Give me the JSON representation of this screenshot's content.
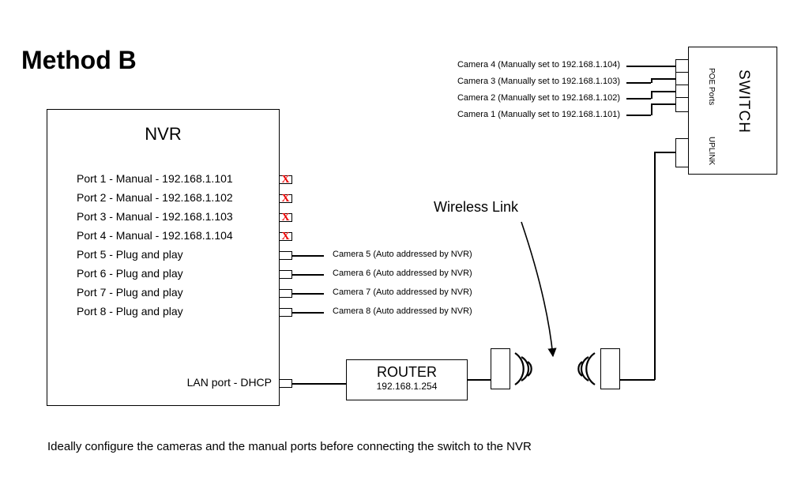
{
  "title": "Method B",
  "nvr": {
    "label": "NVR",
    "ports": [
      {
        "label": "Port 1 - Manual - 192.168.1.101",
        "blocked": true
      },
      {
        "label": "Port 2 - Manual - 192.168.1.102",
        "blocked": true
      },
      {
        "label": "Port 3 - Manual - 192.168.1.103",
        "blocked": true
      },
      {
        "label": "Port 4 - Manual - 192.168.1.104",
        "blocked": true
      },
      {
        "label": "Port 5 - Plug and play",
        "blocked": false
      },
      {
        "label": "Port 6 - Plug and play",
        "blocked": false
      },
      {
        "label": "Port 7 - Plug and play",
        "blocked": false
      },
      {
        "label": "Port 8 - Plug and play",
        "blocked": false
      }
    ],
    "lan": "LAN port - DHCP"
  },
  "local_cameras": [
    "Camera 5 (Auto addressed by NVR)",
    "Camera 6 (Auto addressed by NVR)",
    "Camera 7 (Auto addressed by NVR)",
    "Camera 8 (Auto addressed by NVR)"
  ],
  "remote_cameras": [
    "Camera 4 (Manually set to 192.168.1.104)",
    "Camera 3 (Manually set to 192.168.1.103)",
    "Camera 2 (Manually set to 192.168.1.102)",
    "Camera 1 (Manually set to 192.168.1.101)"
  ],
  "router": {
    "title": "ROUTER",
    "ip": "192.168.1.254"
  },
  "wireless_label": "Wireless Link",
  "switch": {
    "title": "SWITCH",
    "poe": "POE Ports",
    "uplink": "UPLINK"
  },
  "footer": "Ideally configure the cameras and the manual ports before connecting the switch to the NVR"
}
